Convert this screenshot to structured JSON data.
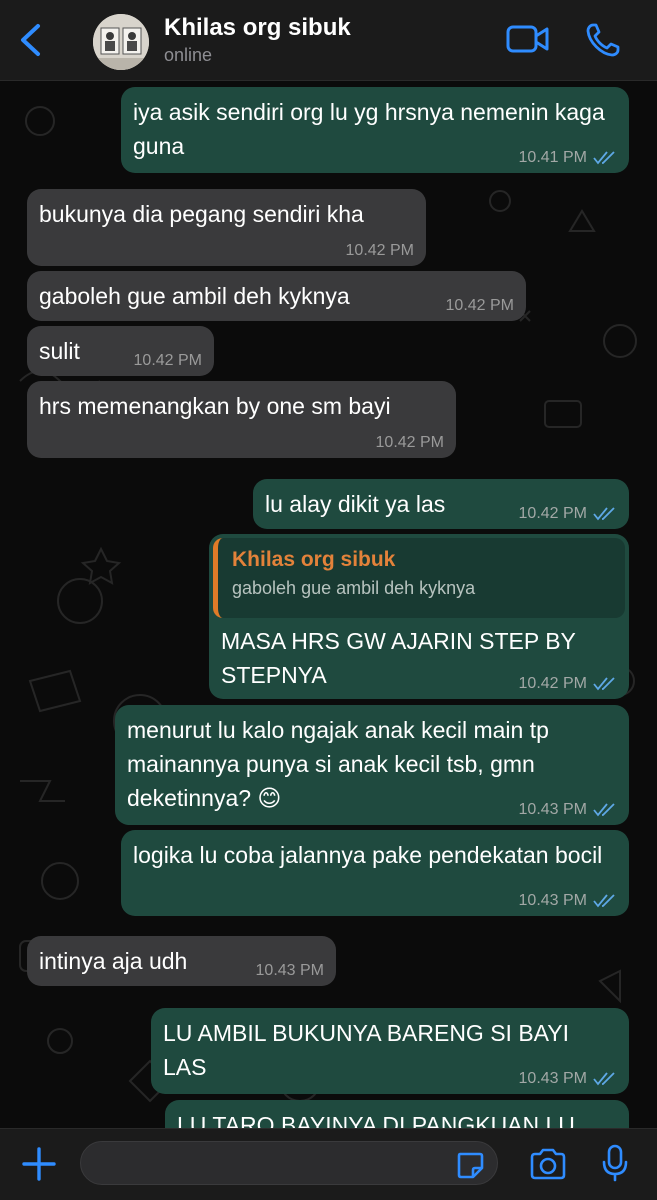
{
  "header": {
    "contact_name": "Khilas org sibuk",
    "status": "online"
  },
  "messages": [
    {
      "direction": "out",
      "text": "iya asik sendiri org lu yg hrsnya nemenin kaga guna",
      "time": "10.41 PM",
      "read": true
    },
    {
      "direction": "in",
      "text": "bukunya dia pegang sendiri kha",
      "time": "10.42 PM"
    },
    {
      "direction": "in",
      "text": "gaboleh gue ambil deh kyknya",
      "time": "10.42 PM"
    },
    {
      "direction": "in",
      "text": "sulit",
      "time": "10.42 PM"
    },
    {
      "direction": "in",
      "text": "hrs memenangkan by one sm bayi",
      "time": "10.42 PM"
    },
    {
      "direction": "out",
      "text": "lu alay dikit ya las",
      "time": "10.42 PM",
      "read": true
    },
    {
      "direction": "out",
      "reply_to": {
        "name": "Khilas org sibuk",
        "text": "gaboleh gue ambil deh kyknya"
      },
      "text": "MASA HRS GW AJARIN STEP BY STEPNYA",
      "time": "10.42 PM",
      "read": true
    },
    {
      "direction": "out",
      "text": "menurut lu kalo ngajak anak kecil main tp mainannya punya si anak kecil tsb, gmn deketinnya? 😊",
      "time": "10.43 PM",
      "read": true
    },
    {
      "direction": "out",
      "text": "logika lu coba jalannya pake pendekatan bocil",
      "time": "10.43 PM",
      "read": true
    },
    {
      "direction": "in",
      "text": "intinya aja udh",
      "time": "10.43 PM"
    },
    {
      "direction": "out",
      "text": "LU AMBIL BUKUNYA BARENG SI BAYI LAS",
      "time": "10.43 PM",
      "read": true
    },
    {
      "direction": "out",
      "text": "LU TARO BAYINYA DI PANGKUAN LU",
      "time": "",
      "read": false
    }
  ],
  "composer": {
    "input_value": "",
    "placeholder": ""
  },
  "colors": {
    "header_bg": "#1b1b1b",
    "chat_bg": "#0b0b0b",
    "incoming_bubble": "#3a3a3c",
    "outgoing_bubble": "#1f4a3f",
    "accent": "#2f8cff",
    "read_ticks": "#5ea8e6",
    "quote_accent": "#e07b28"
  },
  "icons": {
    "back": "chevron-left-icon",
    "video": "video-camera-icon",
    "call": "phone-icon",
    "attach": "plus-icon",
    "sticker": "sticker-icon",
    "camera": "camera-icon",
    "mic": "microphone-icon",
    "read": "double-check-icon"
  }
}
